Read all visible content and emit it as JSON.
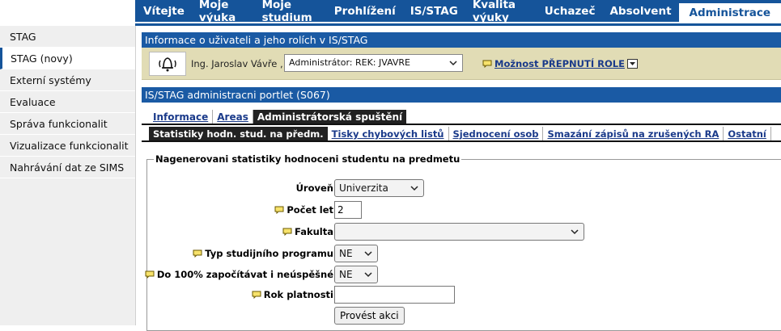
{
  "topnav": {
    "items": [
      "Vítejte",
      "Moje výuka",
      "Moje studium",
      "Prohlížení",
      "IS/STAG",
      "Kvalita výuky",
      "Uchazeč",
      "Absolvent"
    ],
    "active": "Administrace"
  },
  "sidebar": {
    "items": [
      "STAG",
      "STAG (novy)",
      "Externí systémy",
      "Evaluace",
      "Správa funkcionalit",
      "Vizualizace funkcionalit",
      "Nahrávání dat ze SIMS"
    ]
  },
  "userinfo": {
    "title": "Informace o uživateli a jeho rolích v IS/STAG",
    "name": "Ing. Jaroslav Vávře ,",
    "role": "Administrátor: REK: JVAVRE",
    "switch_role": "Možnost PŘEPNUTÍ ROLE"
  },
  "portlet": {
    "title": "IS/STAG administracni portlet (S067)",
    "tabs": [
      "Informace",
      "Areas",
      "Administrátorská spuštění"
    ],
    "subtabs": [
      "Statistiky hodn. stud. na předm.",
      "Tisky chybových listů",
      "Sjednocení osob",
      "Smazání zápisů na zrušených RA",
      "Ostatní"
    ]
  },
  "form": {
    "legend": "Nagenerovani statistiky hodnoceni studentu na predmetu",
    "uroven_label": "Úroveň",
    "uroven_value": "Univerzita",
    "pocet_let_label": "Počet let",
    "pocet_let_value": "2",
    "fakulta_label": "Fakulta",
    "fakulta_value": "",
    "typ_label": "Typ studijního programu",
    "typ_value": "NE",
    "do100_label": "Do 100% započítávat i neúspěšné",
    "do100_value": "NE",
    "rok_label": "Rok platnosti",
    "rok_value": "",
    "submit": "Provést akci"
  },
  "colors": {
    "brand_blue": "#15549a",
    "user_bg": "#e1dcb5",
    "sidebar_bg": "#efefef"
  }
}
